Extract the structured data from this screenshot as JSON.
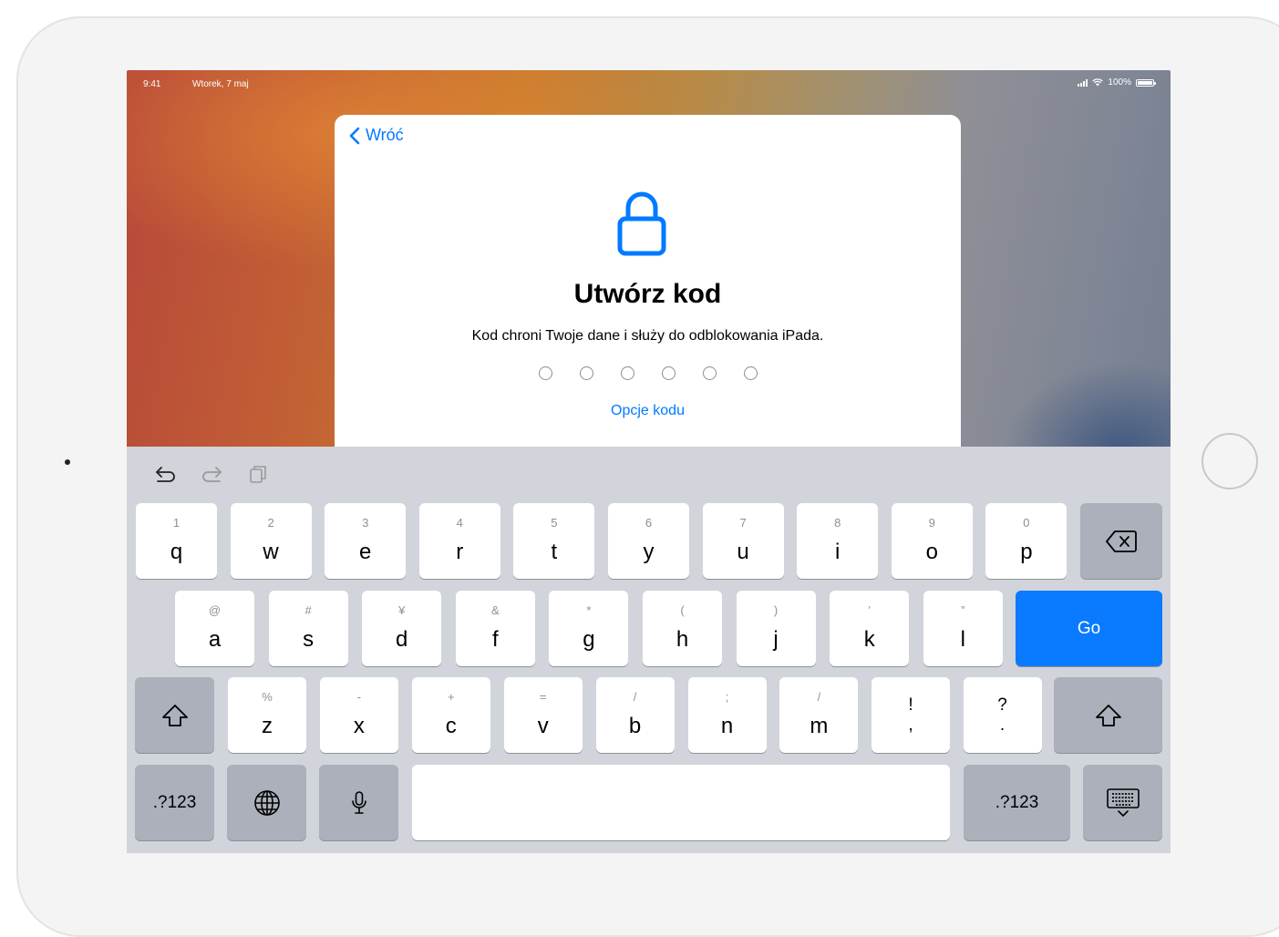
{
  "status_bar": {
    "time": "9:41",
    "date": "Wtorek, 7 maj",
    "battery": "100%"
  },
  "sheet": {
    "back_label": "Wróć",
    "title": "Utwórz kod",
    "subtitle": "Kod chroni Twoje dane i służy do odblokowania iPada.",
    "passcode_length": 6,
    "options_label": "Opcje kodu"
  },
  "keyboard": {
    "row1": [
      {
        "num": "1",
        "letter": "q"
      },
      {
        "num": "2",
        "letter": "w"
      },
      {
        "num": "3",
        "letter": "e"
      },
      {
        "num": "4",
        "letter": "r"
      },
      {
        "num": "5",
        "letter": "t"
      },
      {
        "num": "6",
        "letter": "y"
      },
      {
        "num": "7",
        "letter": "u"
      },
      {
        "num": "8",
        "letter": "i"
      },
      {
        "num": "9",
        "letter": "o"
      },
      {
        "num": "0",
        "letter": "p"
      }
    ],
    "row2": [
      {
        "num": "@",
        "letter": "a"
      },
      {
        "num": "#",
        "letter": "s"
      },
      {
        "num": "¥",
        "letter": "d"
      },
      {
        "num": "&",
        "letter": "f"
      },
      {
        "num": "*",
        "letter": "g"
      },
      {
        "num": "(",
        "letter": "h"
      },
      {
        "num": ")",
        "letter": "j"
      },
      {
        "num": "’",
        "letter": "k"
      },
      {
        "num": "”",
        "letter": "l"
      }
    ],
    "row3": [
      {
        "num": "%",
        "letter": "z"
      },
      {
        "num": "-",
        "letter": "x"
      },
      {
        "num": "+",
        "letter": "c"
      },
      {
        "num": "=",
        "letter": "v"
      },
      {
        "num": "/",
        "letter": "b"
      },
      {
        "num": ";",
        "letter": "n"
      },
      {
        "num": "/",
        "letter": "m"
      }
    ],
    "row3_punct": [
      {
        "top": "!",
        "bottom": ","
      },
      {
        "top": "?",
        "bottom": "."
      }
    ],
    "go_label": "Go",
    "numbers_label_left": ".?123",
    "numbers_label_right": ".?123",
    "accent_color": "#0a7aff"
  }
}
